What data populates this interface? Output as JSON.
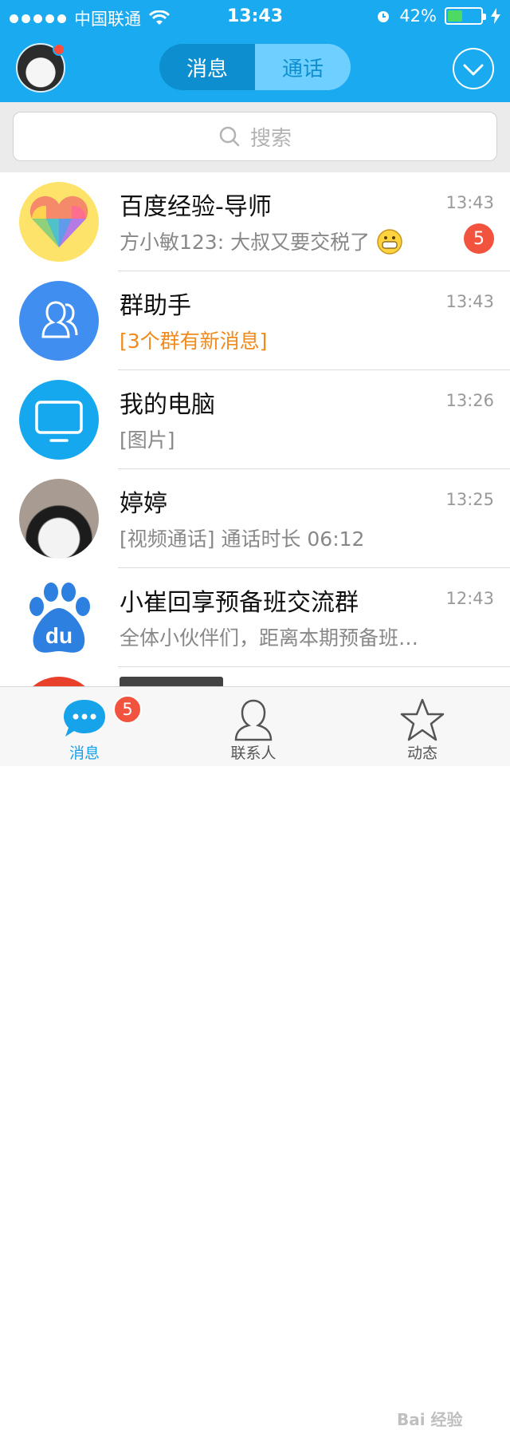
{
  "status_bar": {
    "carrier": "中国联通",
    "time": "13:43",
    "battery": "42%",
    "battery_level": 0.42
  },
  "header": {
    "tabs": [
      {
        "label": "消息",
        "active": true
      },
      {
        "label": "通话",
        "active": false
      }
    ]
  },
  "search": {
    "placeholder": "搜索"
  },
  "conversations": [
    {
      "title": "百度经验-导师",
      "time": "13:43",
      "subtitle": "方小敏123: 大叔又要交税了",
      "badge": "5",
      "avatar": "rainbow-heart"
    },
    {
      "title": "群助手",
      "time": "13:43",
      "subtitle": "[3个群有新消息]",
      "avatar": "group-icon"
    },
    {
      "title": "我的电脑",
      "time": "13:26",
      "subtitle": "[图片]",
      "avatar": "monitor-icon"
    },
    {
      "title": "婷婷",
      "time": "13:25",
      "subtitle": "[视频通话] 通话时长 06:12",
      "avatar": "user-photo"
    },
    {
      "title": "小崔回享预备班交流群",
      "time": "12:43",
      "subtitle": "全体小伙伴们，距离本期预备班…",
      "avatar": "baidu-du-logo"
    }
  ],
  "tabbar": {
    "items": [
      {
        "label": "消息",
        "badge": "5",
        "active": true
      },
      {
        "label": "联系人",
        "active": false
      },
      {
        "label": "动态",
        "active": false
      }
    ]
  },
  "watermark": "Bai 经验",
  "colors": {
    "accent": "#19aaf0",
    "badge": "#f2533e",
    "orange_text": "#f08a1c"
  }
}
